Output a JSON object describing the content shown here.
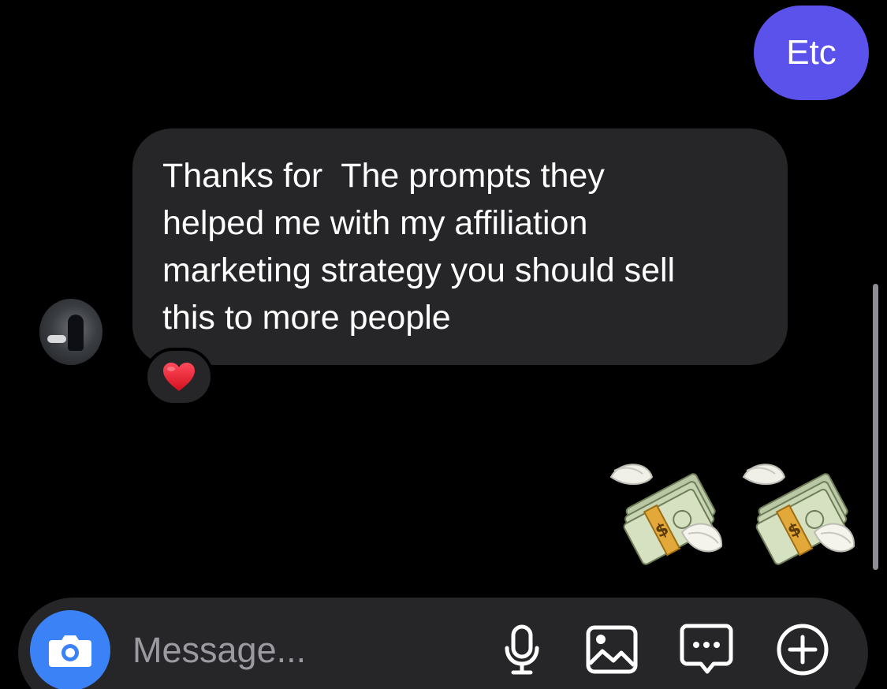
{
  "thread": {
    "outgoing": [
      {
        "text": "Etc"
      }
    ],
    "incoming": [
      {
        "text": "Thanks for  The prompts they\nhelped me with my affiliation\nmarketing strategy you should sell\nthis to more people",
        "reaction": "❤️"
      }
    ],
    "sticker_message": {
      "emojis": [
        "money-with-wings",
        "money-with-wings"
      ]
    }
  },
  "composer": {
    "placeholder": "Message...",
    "accent_color": "#3b82f6",
    "icons": [
      "camera-icon",
      "microphone-icon",
      "gallery-icon",
      "sticker-icon",
      "plus-icon"
    ]
  },
  "colors": {
    "outgoing_bubble": "#5a52ea",
    "incoming_bubble": "#262628",
    "background": "#000000"
  }
}
